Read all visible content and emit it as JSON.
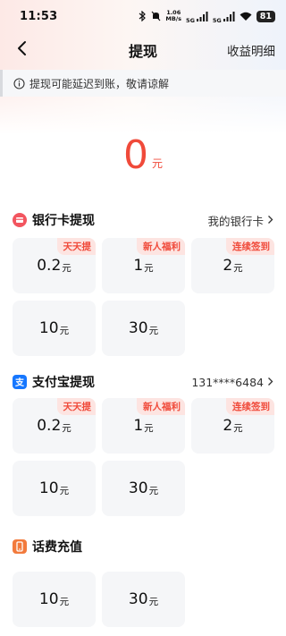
{
  "status_bar": {
    "time": "11:53",
    "net_speed_value": "1.06",
    "net_speed_unit": "MB/s",
    "sig1": "5G",
    "sig2": "5G",
    "battery": "81"
  },
  "nav": {
    "title": "提现",
    "right_link": "收益明细"
  },
  "notice": {
    "text": "提现可能延迟到账，敬请谅解"
  },
  "balance": {
    "amount": "0",
    "unit": "元"
  },
  "bank": {
    "title": "银行卡提现",
    "right": "我的银行卡",
    "options": [
      {
        "amount": "0.2",
        "unit": "元",
        "tag": "天天提"
      },
      {
        "amount": "1",
        "unit": "元",
        "tag": "新人福利"
      },
      {
        "amount": "2",
        "unit": "元",
        "tag": "连续签到"
      },
      {
        "amount": "10",
        "unit": "元",
        "tag": ""
      },
      {
        "amount": "30",
        "unit": "元",
        "tag": ""
      }
    ]
  },
  "alipay": {
    "title": "支付宝提现",
    "right": "131****6484",
    "options": [
      {
        "amount": "0.2",
        "unit": "元",
        "tag": "天天提"
      },
      {
        "amount": "1",
        "unit": "元",
        "tag": "新人福利"
      },
      {
        "amount": "2",
        "unit": "元",
        "tag": "连续签到"
      },
      {
        "amount": "10",
        "unit": "元",
        "tag": ""
      },
      {
        "amount": "30",
        "unit": "元",
        "tag": ""
      }
    ]
  },
  "phone": {
    "title": "话费充值",
    "options": [
      {
        "amount": "10",
        "unit": "元"
      },
      {
        "amount": "30",
        "unit": "元"
      }
    ]
  },
  "colors": {
    "accent": "#f04a3a",
    "tag_bg": "#fde4e1",
    "card_bg": "#f5f6f8",
    "alipay_blue": "#1677ff",
    "phone_orange": "#f27a3c"
  },
  "icons": {
    "bank": "bank-card-icon",
    "alipay": "alipay-icon",
    "phone": "phone-icon",
    "notice": "info-icon",
    "back": "back-arrow-icon",
    "chevron": "chevron-right-icon"
  }
}
